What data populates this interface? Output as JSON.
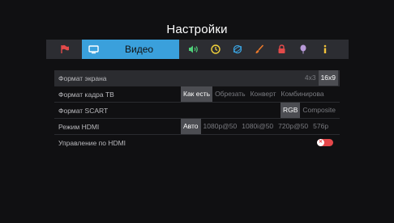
{
  "header": {
    "title": "Настройки"
  },
  "tabs": {
    "active_label": "Видео",
    "icons": [
      "flag-icon",
      "tv-icon",
      "audio-icon",
      "clock-icon",
      "globe-icon",
      "brush-icon",
      "lock-icon",
      "balloon-icon",
      "info-icon"
    ]
  },
  "settings": {
    "rows": [
      {
        "label": "Формат экрана",
        "options": [
          "4x3",
          "16x9"
        ],
        "selected": "16x9"
      },
      {
        "label": "Формат кадра ТВ",
        "options": [
          "Как есть",
          "Обрезать",
          "Конверт",
          "Комбинирова"
        ],
        "selected": "Как есть"
      },
      {
        "label": "Формат SCART",
        "options": [
          "RGB",
          "Composite"
        ],
        "selected": "RGB"
      },
      {
        "label": "Режим HDMI",
        "options": [
          "Авто",
          "1080p@50",
          "1080i@50",
          "720p@50",
          "576p"
        ],
        "selected": "Авто"
      },
      {
        "label": "Управление по HDMI",
        "toggle": "off"
      }
    ]
  },
  "colors": {
    "accent": "#3aa0dc",
    "tab_bar": "#2c2d32",
    "flag": "#e24a4a",
    "audio": "#4fd07a",
    "clock": "#f2d23a",
    "globe": "#3aa0dc",
    "brush": "#ee7a2a",
    "lock": "#e24a4a",
    "balloon": "#b89ad8",
    "info": "#f2c23a",
    "toggle_off": "#e5474a"
  }
}
